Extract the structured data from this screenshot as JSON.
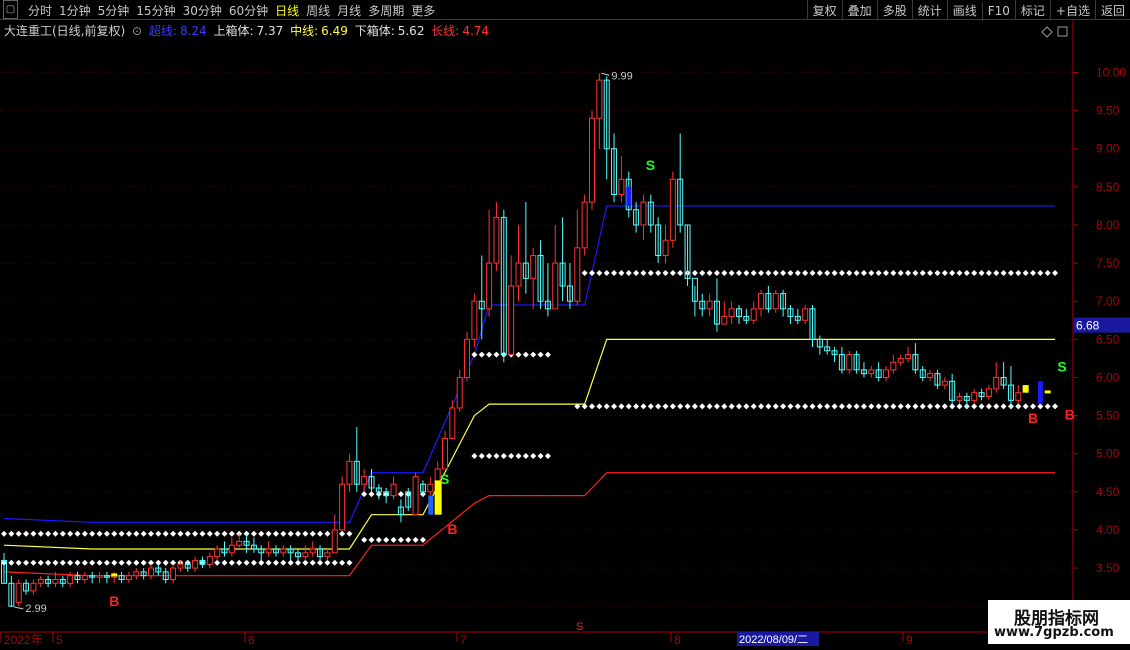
{
  "toolbar": {
    "periods": [
      "分时",
      "1分钟",
      "5分钟",
      "15分钟",
      "30分钟",
      "60分钟",
      "日线",
      "周线",
      "月线",
      "多周期",
      "更多"
    ],
    "active_period": "日线",
    "right": [
      "复权",
      "叠加",
      "多股",
      "统计",
      "画线",
      "F10",
      "标记",
      "+自选",
      "返回"
    ]
  },
  "info": {
    "title": "大连重工(日线,前复权)",
    "ind1_label": "超线:",
    "ind1_value": "8.24",
    "ind2_label": "上箱体:",
    "ind2_value": "7.37",
    "ind3_label": "中线:",
    "ind3_value": "6.49",
    "ind4_label": "下箱体:",
    "ind4_value": "5.62",
    "ind5_label": "长线:",
    "ind5_value": "4.74"
  },
  "colors": {
    "up": "#ff3232",
    "down": "#54ffff",
    "blue_line": "#1a1aff",
    "yellow_line": "#ffff40",
    "red_line": "#ff2020",
    "axis": "#b00000",
    "dots": "#ffffff",
    "signal_b": "#ff2020",
    "signal_s": "#20ff20"
  },
  "axis": {
    "y_labels": [
      "10.00",
      "9.50",
      "9.00",
      "8.50",
      "8.00",
      "7.50",
      "7.00",
      "6.50",
      "6.00",
      "5.50",
      "5.00",
      "4.50",
      "4.00",
      "3.50",
      "3.00"
    ],
    "current_price": "6.68",
    "x_labels": [
      "2022年",
      "5",
      "6",
      "7",
      "8",
      "9"
    ],
    "cursor_date": "2022/08/09/二",
    "x_marker": "S"
  },
  "annotations": {
    "high": "9.99",
    "low": "2.99",
    "b_label": "B",
    "s_label": "S"
  },
  "watermark": {
    "line1": "股朋指标网",
    "line2": "www.7gpzb.com"
  },
  "chart_data": {
    "type": "candlestick",
    "ylim": [
      2.95,
      10.4
    ],
    "candles": [
      [
        3.6,
        3.3,
        3.7,
        3.3
      ],
      [
        3.3,
        3.0,
        3.4,
        2.99
      ],
      [
        3.05,
        3.3,
        3.35,
        3.0
      ],
      [
        3.3,
        3.2,
        3.35,
        3.15
      ],
      [
        3.2,
        3.3,
        3.35,
        3.15
      ],
      [
        3.3,
        3.35,
        3.4,
        3.25
      ],
      [
        3.35,
        3.3,
        3.4,
        3.25
      ],
      [
        3.3,
        3.35,
        3.45,
        3.25
      ],
      [
        3.35,
        3.3,
        3.4,
        3.25
      ],
      [
        3.3,
        3.4,
        3.45,
        3.25
      ],
      [
        3.4,
        3.35,
        3.45,
        3.3
      ],
      [
        3.35,
        3.4,
        3.45,
        3.3
      ],
      [
        3.4,
        3.38,
        3.45,
        3.3
      ],
      [
        3.38,
        3.4,
        3.45,
        3.3
      ],
      [
        3.4,
        3.38,
        3.45,
        3.3
      ],
      [
        3.38,
        3.4,
        3.45,
        3.3
      ],
      [
        3.4,
        3.35,
        3.45,
        3.3
      ],
      [
        3.35,
        3.4,
        3.45,
        3.3
      ],
      [
        3.4,
        3.45,
        3.5,
        3.35
      ],
      [
        3.45,
        3.4,
        3.5,
        3.35
      ],
      [
        3.4,
        3.5,
        3.55,
        3.35
      ],
      [
        3.5,
        3.45,
        3.55,
        3.4
      ],
      [
        3.45,
        3.35,
        3.5,
        3.3
      ],
      [
        3.35,
        3.5,
        3.55,
        3.3
      ],
      [
        3.5,
        3.55,
        3.6,
        3.45
      ],
      [
        3.55,
        3.5,
        3.6,
        3.45
      ],
      [
        3.5,
        3.6,
        3.65,
        3.45
      ],
      [
        3.6,
        3.55,
        3.65,
        3.5
      ],
      [
        3.55,
        3.65,
        3.7,
        3.5
      ],
      [
        3.65,
        3.75,
        3.8,
        3.6
      ],
      [
        3.75,
        3.7,
        3.85,
        3.65
      ],
      [
        3.7,
        3.8,
        3.9,
        3.65
      ],
      [
        3.8,
        3.85,
        3.95,
        3.75
      ],
      [
        3.85,
        3.8,
        3.95,
        3.7
      ],
      [
        3.8,
        3.75,
        3.9,
        3.7
      ],
      [
        3.75,
        3.7,
        3.8,
        3.6
      ],
      [
        3.7,
        3.75,
        3.85,
        3.65
      ],
      [
        3.75,
        3.7,
        3.8,
        3.65
      ],
      [
        3.7,
        3.75,
        3.8,
        3.65
      ],
      [
        3.75,
        3.7,
        3.8,
        3.6
      ],
      [
        3.7,
        3.65,
        3.75,
        3.6
      ],
      [
        3.65,
        3.7,
        3.8,
        3.6
      ],
      [
        3.7,
        3.75,
        3.85,
        3.65
      ],
      [
        3.75,
        3.65,
        3.8,
        3.6
      ],
      [
        3.65,
        3.7,
        3.75,
        3.6
      ],
      [
        3.7,
        4.0,
        4.2,
        3.7
      ],
      [
        4.0,
        4.6,
        4.7,
        4.0
      ],
      [
        4.6,
        4.9,
        5.0,
        4.5
      ],
      [
        4.9,
        4.6,
        5.35,
        4.5
      ],
      [
        4.6,
        4.7,
        4.8,
        4.5
      ],
      [
        4.7,
        4.55,
        4.8,
        4.5
      ],
      [
        4.55,
        4.5,
        4.6,
        4.4
      ],
      [
        4.5,
        4.45,
        4.55,
        4.35
      ],
      [
        4.45,
        4.6,
        4.7,
        4.4
      ],
      [
        4.3,
        4.2,
        4.4,
        4.1
      ],
      [
        4.5,
        4.3,
        4.55,
        4.25
      ],
      [
        4.2,
        4.7,
        4.75,
        4.2
      ],
      [
        4.6,
        4.5,
        4.65,
        4.45
      ],
      [
        4.5,
        4.6,
        4.7,
        4.4
      ],
      [
        4.6,
        4.8,
        4.9,
        4.55
      ],
      [
        4.8,
        5.2,
        5.3,
        4.8
      ],
      [
        5.2,
        5.6,
        5.7,
        5.2
      ],
      [
        5.6,
        6.0,
        6.1,
        5.55
      ],
      [
        6.0,
        6.5,
        6.6,
        5.95
      ],
      [
        6.5,
        7.0,
        7.1,
        6.4
      ],
      [
        7.0,
        6.9,
        7.6,
        6.5
      ],
      [
        6.9,
        7.5,
        8.2,
        6.8
      ],
      [
        7.5,
        8.1,
        8.3,
        7.4
      ],
      [
        8.1,
        6.3,
        8.2,
        6.2
      ],
      [
        6.3,
        7.2,
        7.6,
        6.3
      ],
      [
        7.2,
        7.5,
        8.0,
        7.0
      ],
      [
        7.5,
        7.3,
        8.3,
        7.1
      ],
      [
        7.3,
        7.6,
        7.7,
        6.9
      ],
      [
        7.6,
        7.0,
        7.8,
        6.9
      ],
      [
        7.0,
        6.9,
        7.5,
        6.8
      ],
      [
        6.9,
        7.5,
        8.0,
        6.9
      ],
      [
        7.5,
        7.2,
        8.1,
        7.0
      ],
      [
        7.2,
        7.0,
        7.5,
        6.9
      ],
      [
        7.0,
        7.7,
        8.2,
        6.95
      ],
      [
        7.7,
        8.3,
        8.4,
        7.6
      ],
      [
        8.3,
        9.4,
        9.5,
        8.2
      ],
      [
        9.4,
        9.9,
        9.99,
        9.0
      ],
      [
        9.9,
        9.0,
        9.95,
        8.6
      ],
      [
        9.0,
        8.4,
        9.2,
        8.3
      ],
      [
        8.4,
        8.6,
        8.9,
        8.3
      ],
      [
        8.6,
        8.2,
        8.7,
        8.1
      ],
      [
        8.2,
        8.0,
        8.3,
        7.9
      ],
      [
        8.0,
        8.3,
        8.4,
        7.8
      ],
      [
        8.3,
        8.0,
        8.4,
        7.9
      ],
      [
        8.0,
        7.6,
        8.1,
        7.5
      ],
      [
        7.6,
        7.8,
        8.0,
        7.5
      ],
      [
        7.8,
        8.6,
        8.7,
        7.7
      ],
      [
        8.6,
        8.0,
        9.2,
        7.9
      ],
      [
        8.0,
        7.3,
        8.0,
        7.2
      ],
      [
        7.3,
        7.0,
        7.2,
        6.8
      ],
      [
        7.0,
        6.9,
        7.1,
        6.8
      ],
      [
        6.9,
        7.0,
        7.1,
        6.8
      ],
      [
        7.0,
        6.7,
        7.3,
        6.6
      ],
      [
        6.7,
        6.8,
        7.0,
        6.7
      ],
      [
        6.8,
        6.9,
        7.0,
        6.7
      ],
      [
        6.9,
        6.8,
        6.95,
        6.7
      ],
      [
        6.8,
        6.75,
        6.9,
        6.7
      ],
      [
        6.75,
        6.9,
        7.0,
        6.7
      ],
      [
        6.9,
        7.1,
        7.15,
        6.8
      ],
      [
        7.1,
        6.9,
        7.2,
        6.85
      ],
      [
        6.9,
        7.1,
        7.15,
        6.85
      ],
      [
        7.1,
        6.9,
        7.15,
        6.8
      ],
      [
        6.9,
        6.8,
        6.95,
        6.7
      ],
      [
        6.8,
        6.75,
        6.9,
        6.7
      ],
      [
        6.75,
        6.9,
        6.95,
        6.7
      ],
      [
        6.9,
        6.5,
        6.95,
        6.4
      ],
      [
        6.5,
        6.4,
        6.55,
        6.3
      ],
      [
        6.4,
        6.35,
        6.5,
        6.3
      ],
      [
        6.35,
        6.3,
        6.4,
        6.2
      ],
      [
        6.3,
        6.1,
        6.4,
        6.05
      ],
      [
        6.1,
        6.3,
        6.35,
        6.05
      ],
      [
        6.3,
        6.1,
        6.35,
        6.05
      ],
      [
        6.1,
        6.05,
        6.2,
        6.0
      ],
      [
        6.05,
        6.1,
        6.15,
        6.0
      ],
      [
        6.1,
        6.0,
        6.2,
        5.95
      ],
      [
        6.0,
        6.1,
        6.15,
        5.95
      ],
      [
        6.1,
        6.2,
        6.3,
        6.05
      ],
      [
        6.2,
        6.25,
        6.3,
        6.15
      ],
      [
        6.25,
        6.3,
        6.4,
        6.2
      ],
      [
        6.3,
        6.1,
        6.45,
        6.05
      ],
      [
        6.1,
        6.0,
        6.15,
        5.95
      ],
      [
        6.0,
        6.05,
        6.1,
        5.95
      ],
      [
        6.05,
        5.9,
        6.1,
        5.85
      ],
      [
        5.9,
        5.95,
        6.0,
        5.85
      ],
      [
        5.95,
        5.7,
        6.05,
        5.65
      ],
      [
        5.7,
        5.75,
        5.8,
        5.65
      ],
      [
        5.75,
        5.7,
        5.8,
        5.6
      ],
      [
        5.7,
        5.8,
        5.85,
        5.65
      ],
      [
        5.8,
        5.75,
        5.85,
        5.7
      ],
      [
        5.75,
        5.85,
        5.9,
        5.7
      ],
      [
        5.85,
        6.0,
        6.2,
        5.8
      ],
      [
        6.0,
        5.9,
        6.2,
        5.85
      ],
      [
        5.9,
        5.7,
        6.15,
        5.6
      ],
      [
        5.7,
        5.8,
        5.9,
        5.65
      ]
    ],
    "blue_line": [
      [
        0,
        4.15
      ],
      [
        12,
        4.1
      ],
      [
        47,
        4.1
      ],
      [
        50,
        4.75
      ],
      [
        57,
        4.75
      ],
      [
        64,
        6.3
      ],
      [
        66,
        6.95
      ],
      [
        79,
        6.95
      ],
      [
        82,
        8.25
      ],
      [
        143,
        8.25
      ]
    ],
    "yellow_line": [
      [
        0,
        3.8
      ],
      [
        12,
        3.75
      ],
      [
        47,
        3.75
      ],
      [
        50,
        4.2
      ],
      [
        57,
        4.2
      ],
      [
        64,
        5.5
      ],
      [
        66,
        5.65
      ],
      [
        79,
        5.65
      ],
      [
        82,
        6.5
      ],
      [
        143,
        6.5
      ]
    ],
    "red_line": [
      [
        0,
        3.45
      ],
      [
        12,
        3.4
      ],
      [
        47,
        3.4
      ],
      [
        50,
        3.8
      ],
      [
        57,
        3.8
      ],
      [
        64,
        4.35
      ],
      [
        66,
        4.45
      ],
      [
        79,
        4.45
      ],
      [
        82,
        4.75
      ],
      [
        143,
        4.75
      ]
    ],
    "dot_rows": [
      {
        "from": 0,
        "to": 47,
        "value": 3.95
      },
      {
        "from": 0,
        "to": 47,
        "value": 3.57
      },
      {
        "from": 49,
        "to": 57,
        "value": 4.47
      },
      {
        "from": 49,
        "to": 57,
        "value": 3.87
      },
      {
        "from": 64,
        "to": 74,
        "value": 6.3
      },
      {
        "from": 64,
        "to": 74,
        "value": 4.97
      },
      {
        "from": 78,
        "to": 143,
        "value": 7.37
      },
      {
        "from": 78,
        "to": 143,
        "value": 5.62
      }
    ]
  }
}
